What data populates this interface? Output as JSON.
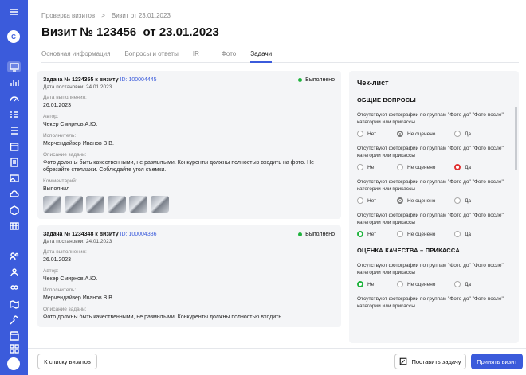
{
  "breadcrumb": {
    "root": "Проверка визитов",
    "sep": ">",
    "current": "Визит от 23.01.2023"
  },
  "title": "Визит № 123456  от 23.01.2023",
  "tabs": [
    "Основная информация",
    "Вопросы и ответы",
    "IR",
    "Фото",
    "Задачи"
  ],
  "active_tab": "Задачи",
  "tasks": [
    {
      "title": "Задача № 1234355 к визиту",
      "id": "ID: 100004445",
      "status": "Выполнено",
      "created": "Дата постановки: 24.01.2023",
      "due_label": "Дата выполнения:",
      "due": "26.01.2023",
      "author_label": "Автор:",
      "author": "Чекер Смирнов А.Ю.",
      "exec_label": "Исполнитель:",
      "exec": "Мерчендайзер Иванов В.В.",
      "desc_label": "Описание задачи:",
      "desc": "Фото должны быть качественными, не размытыми. Конкуренты должны полностью входить на фото. Не обрезайте стеллажи. Соблюдайте угол съемки.",
      "comment_label": "Комментарий:",
      "comment": "Выполнил"
    },
    {
      "title": "Задача № 1234348 к визиту",
      "id": "ID: 100004336",
      "status": "Выполнено",
      "created": "Дата постановки: 24.01.2023",
      "due_label": "Дата выполнения:",
      "due": "26.01.2023",
      "author_label": "Автор:",
      "author": "Чекер Смирнов А.Ю.",
      "exec_label": "Исполнитель:",
      "exec": "Мерчендайзер Иванов В.В.",
      "desc_label": "Описание задачи:",
      "desc": "Фото должны быть качественными, не размытыми. Конкуренты должны полностью входить"
    }
  ],
  "checklist": {
    "title": "Чек-лист",
    "sections": [
      {
        "name": "ОБЩИЕ ВОПРОСЫ",
        "questions": [
          {
            "text": "Отсутствуют фотографии по группам \"Фото до\" \"Фото после\", категории или прикассы",
            "selected": "Не оценено",
            "style": "grey"
          },
          {
            "text": "Отсутствуют фотографии по группам \"Фото до\" \"Фото после\", категории или прикассы",
            "selected": "Да",
            "style": "red"
          },
          {
            "text": "Отсутствуют фотографии по группам \"Фото до\" \"Фото после\", категории или прикассы",
            "selected": "Не оценено",
            "style": "grey"
          },
          {
            "text": "Отсутствуют фотографии по группам \"Фото до\" \"Фото после\", категории или прикассы",
            "selected": "Нет",
            "style": "green"
          }
        ]
      },
      {
        "name": "ОЦЕНКА КАЧЕСТВА – ПРИКАССА",
        "questions": [
          {
            "text": "Отсутствуют фотографии по группам \"Фото до\" \"Фото после\", категории или прикассы",
            "selected": "Нет",
            "style": "green"
          },
          {
            "text": "Отсутствуют фотографии по группам \"Фото до\" \"Фото после\", категории или прикассы",
            "selected": "",
            "style": ""
          }
        ]
      }
    ],
    "options": [
      "Нет",
      "Не оценено",
      "Да"
    ]
  },
  "footer": {
    "back": "К списку визитов",
    "set_task": "Поставить задачу",
    "accept": "Принять визит"
  },
  "colors": {
    "accent": "#3b5bdb",
    "done": "#1fb33d",
    "no": "#e03131"
  }
}
